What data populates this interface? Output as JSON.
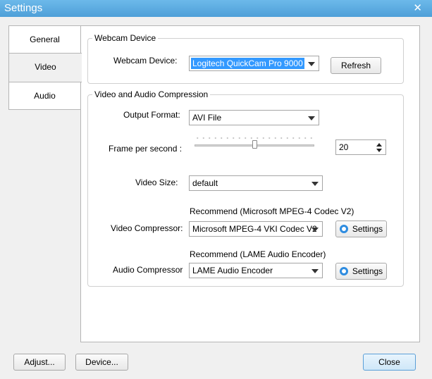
{
  "window": {
    "title": "Settings",
    "close_glyph": "✕"
  },
  "tabs": [
    {
      "label": "General"
    },
    {
      "label": "Video"
    },
    {
      "label": "Audio"
    }
  ],
  "webcam_group": {
    "title": "Webcam Device",
    "device_label": "Webcam Device:",
    "device_value": "Logitech QuickCam Pro 9000",
    "refresh_label": "Refresh"
  },
  "compression_group": {
    "title": "Video and Audio Compression",
    "output_format_label": "Output Format:",
    "output_format_value": "AVI File",
    "fps_label": "Frame per second :",
    "fps_slider_fraction": 0.5,
    "fps_value": "20",
    "video_size_label": "Video Size:",
    "video_size_value": "default",
    "video_recommend": "Recommend (Microsoft MPEG-4 Codec V2)",
    "video_compressor_label": "Video Compressor:",
    "video_compressor_value": "Microsoft MPEG-4  VKI  Codec V2",
    "video_settings_label": "Settings",
    "audio_recommend": "Recommend (LAME Audio Encoder)",
    "audio_compressor_label": "Audio Compressor",
    "audio_compressor_value": "LAME Audio Encoder",
    "audio_settings_label": "Settings"
  },
  "footer": {
    "adjust_label": "Adjust...",
    "device_label": "Device...",
    "close_label": "Close"
  },
  "colors": {
    "titlebar": "#5aa9de",
    "selection": "#3399ff",
    "settings_icon": "#2e8ce0"
  }
}
